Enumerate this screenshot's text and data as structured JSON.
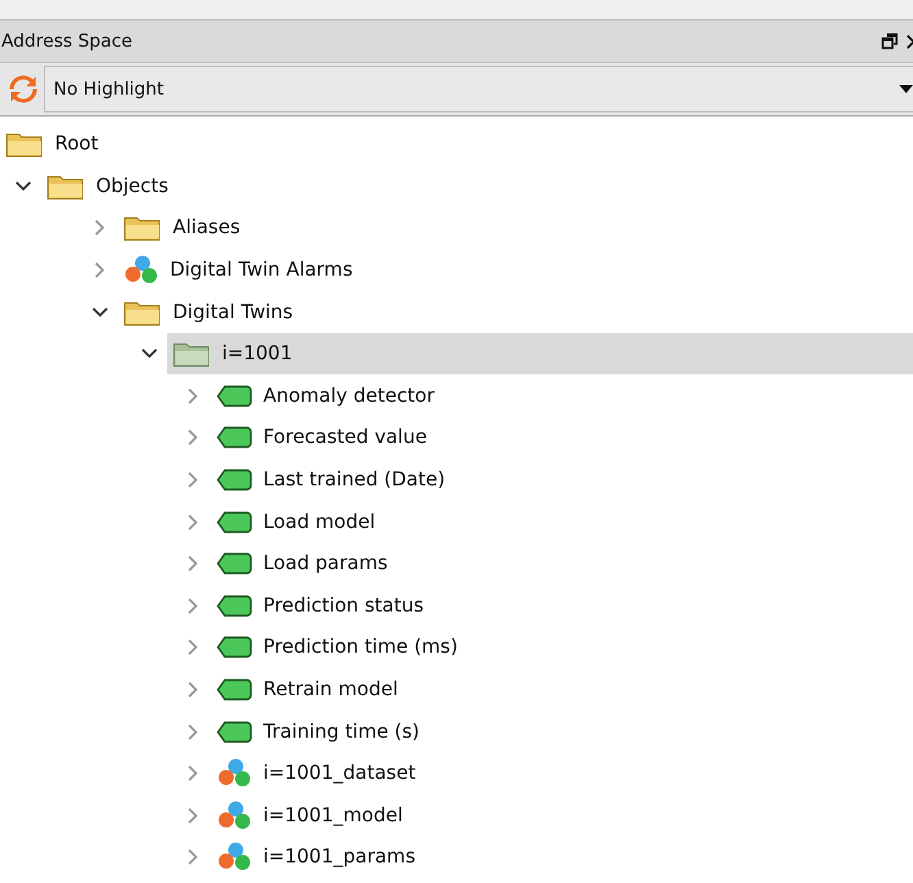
{
  "panel": {
    "title": "Address Space",
    "toolbar": {
      "value": "No Highlight"
    }
  },
  "tree": [
    {
      "label": "Root",
      "kind": "folder",
      "show_toggle": false,
      "selected": false,
      "children": [
        {
          "label": "Objects",
          "kind": "folder",
          "show_toggle": true,
          "expanded": true,
          "selected": false,
          "children": [
            {
              "label": "Aliases",
              "kind": "folder",
              "show_toggle": true,
              "expanded": false,
              "selected": false
            },
            {
              "label": "Digital Twin Alarms",
              "kind": "object",
              "show_toggle": true,
              "expanded": false,
              "selected": false
            },
            {
              "label": "Digital Twins",
              "kind": "folder",
              "show_toggle": true,
              "expanded": true,
              "selected": false,
              "children": [
                {
                  "label": "i=1001",
                  "kind": "instance",
                  "show_toggle": true,
                  "expanded": true,
                  "selected": true,
                  "children": [
                    {
                      "label": "Anomaly detector",
                      "kind": "variable",
                      "show_toggle": true,
                      "expanded": false,
                      "selected": false
                    },
                    {
                      "label": "Forecasted value",
                      "kind": "variable",
                      "show_toggle": true,
                      "expanded": false,
                      "selected": false
                    },
                    {
                      "label": "Last trained (Date)",
                      "kind": "variable",
                      "show_toggle": true,
                      "expanded": false,
                      "selected": false
                    },
                    {
                      "label": "Load model",
                      "kind": "variable",
                      "show_toggle": true,
                      "expanded": false,
                      "selected": false
                    },
                    {
                      "label": "Load params",
                      "kind": "variable",
                      "show_toggle": true,
                      "expanded": false,
                      "selected": false
                    },
                    {
                      "label": "Prediction status",
                      "kind": "variable",
                      "show_toggle": true,
                      "expanded": false,
                      "selected": false
                    },
                    {
                      "label": "Prediction time (ms)",
                      "kind": "variable",
                      "show_toggle": true,
                      "expanded": false,
                      "selected": false
                    },
                    {
                      "label": "Retrain model",
                      "kind": "variable",
                      "show_toggle": true,
                      "expanded": false,
                      "selected": false
                    },
                    {
                      "label": "Training time (s)",
                      "kind": "variable",
                      "show_toggle": true,
                      "expanded": false,
                      "selected": false
                    },
                    {
                      "label": "i=1001_dataset",
                      "kind": "object",
                      "show_toggle": true,
                      "expanded": false,
                      "selected": false
                    },
                    {
                      "label": "i=1001_model",
                      "kind": "object",
                      "show_toggle": true,
                      "expanded": false,
                      "selected": false
                    },
                    {
                      "label": "i=1001_params",
                      "kind": "object",
                      "show_toggle": true,
                      "expanded": false,
                      "selected": false
                    }
                  ]
                }
              ]
            }
          ]
        }
      ]
    }
  ]
}
